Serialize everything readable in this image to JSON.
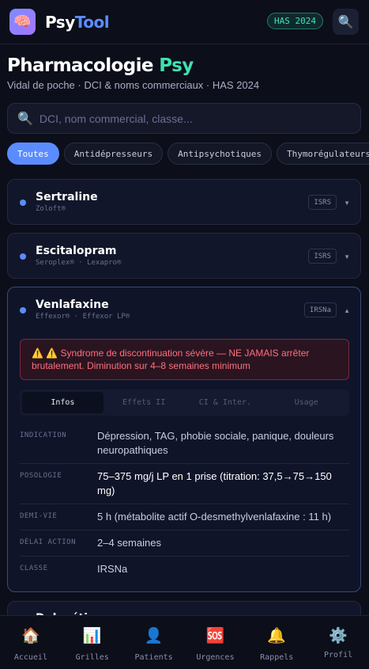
{
  "app": {
    "logo_icon": "🧠",
    "name_part1": "Psy",
    "name_part2": "Tool",
    "badge": "HAS 2024",
    "search_icon": "🔍"
  },
  "page": {
    "title_main": "Pharmacologie",
    "title_accent": "Psy",
    "subtitle": "Vidal de poche · DCI & noms commerciaux · HAS 2024"
  },
  "search": {
    "icon": "🔍",
    "placeholder": "DCI, nom commercial, classe..."
  },
  "filters": [
    "Toutes",
    "Antidépresseurs",
    "Antipsychotiques",
    "Thymorégulateurs"
  ],
  "drugs": [
    {
      "name": "Sertraline",
      "brands": "Zoloft®",
      "class": "ISRS",
      "chevron": "▼"
    },
    {
      "name": "Escitalopram",
      "brands": "Seroplex® · Lexapro®",
      "class": "ISRS",
      "chevron": "▼"
    },
    {
      "name": "Venlafaxine",
      "brands": "Effexor® · Effexor LP®",
      "class": "IRSNa",
      "chevron": "▲",
      "warning": "⚠️ ⚠️ Syndrome de discontinuation sévère — NE JAMAIS arrêter brutalement. Diminution sur 4–8 semaines minimum",
      "tabs": [
        "Infos",
        "Effets II",
        "CI & Inter.",
        "Usage"
      ],
      "details": [
        {
          "label": "INDICATION",
          "value": "Dépression, TAG, phobie sociale, panique, douleurs neuropathiques"
        },
        {
          "label": "POSOLOGIE",
          "value": "75–375 mg/j LP en 1 prise (titration: 37,5→75→150 mg)"
        },
        {
          "label": "DEMI-VIE",
          "value": "5 h (métabolite actif O-desmethylvenlafaxine : 11 h)"
        },
        {
          "label": "DÉLAI ACTION",
          "value": "2–4 semaines"
        },
        {
          "label": "CLASSE",
          "value": "IRSNa"
        }
      ]
    },
    {
      "name": "Duloxétine"
    }
  ],
  "nav": [
    {
      "icon": "🏠",
      "label": "Accueil"
    },
    {
      "icon": "📊",
      "label": "Grilles"
    },
    {
      "icon": "👤",
      "label": "Patients"
    },
    {
      "icon": "🆘",
      "label": "Urgences"
    },
    {
      "icon": "🔔",
      "label": "Rappels"
    },
    {
      "icon": "⚙️",
      "label": "Profil"
    }
  ],
  "colors": {
    "background": "#0c0e1a",
    "accent_blue": "#5b8cff",
    "accent_teal": "#3fe0b0",
    "warning_red": "#ff6f7e"
  }
}
